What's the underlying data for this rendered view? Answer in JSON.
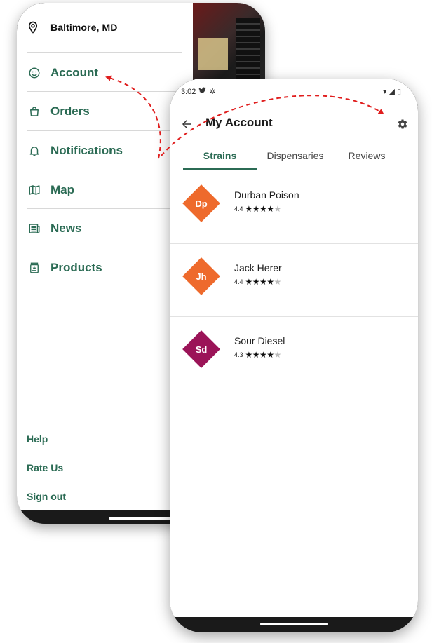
{
  "drawer": {
    "location": "Baltimore, MD",
    "location_icon": "location-pin-icon",
    "items": [
      {
        "label": "Account",
        "icon": "smiley-icon"
      },
      {
        "label": "Orders",
        "icon": "shopping-bag-icon"
      },
      {
        "label": "Notifications",
        "icon": "bell-icon"
      },
      {
        "label": "Map",
        "icon": "map-icon"
      },
      {
        "label": "News",
        "icon": "newspaper-icon"
      },
      {
        "label": "Products",
        "icon": "jar-icon"
      }
    ],
    "footer": [
      "Help",
      "Rate Us",
      "Sign out"
    ]
  },
  "account": {
    "status_time": "3:02",
    "title": "My Account",
    "tabs": [
      "Strains",
      "Dispensaries",
      "Reviews"
    ],
    "active_tab": "Strains",
    "strains": [
      {
        "abbr": "Dp",
        "name": "Durban Poison",
        "rating": "4.4",
        "color": "#ee6a2c"
      },
      {
        "abbr": "Jh",
        "name": "Jack Herer",
        "rating": "4.4",
        "color": "#ee6a2c"
      },
      {
        "abbr": "Sd",
        "name": "Sour Diesel",
        "rating": "4.3",
        "color": "#9b1458"
      }
    ]
  },
  "colors": {
    "brand_green": "#2b6b54",
    "arrow_red": "#e01e1e"
  }
}
